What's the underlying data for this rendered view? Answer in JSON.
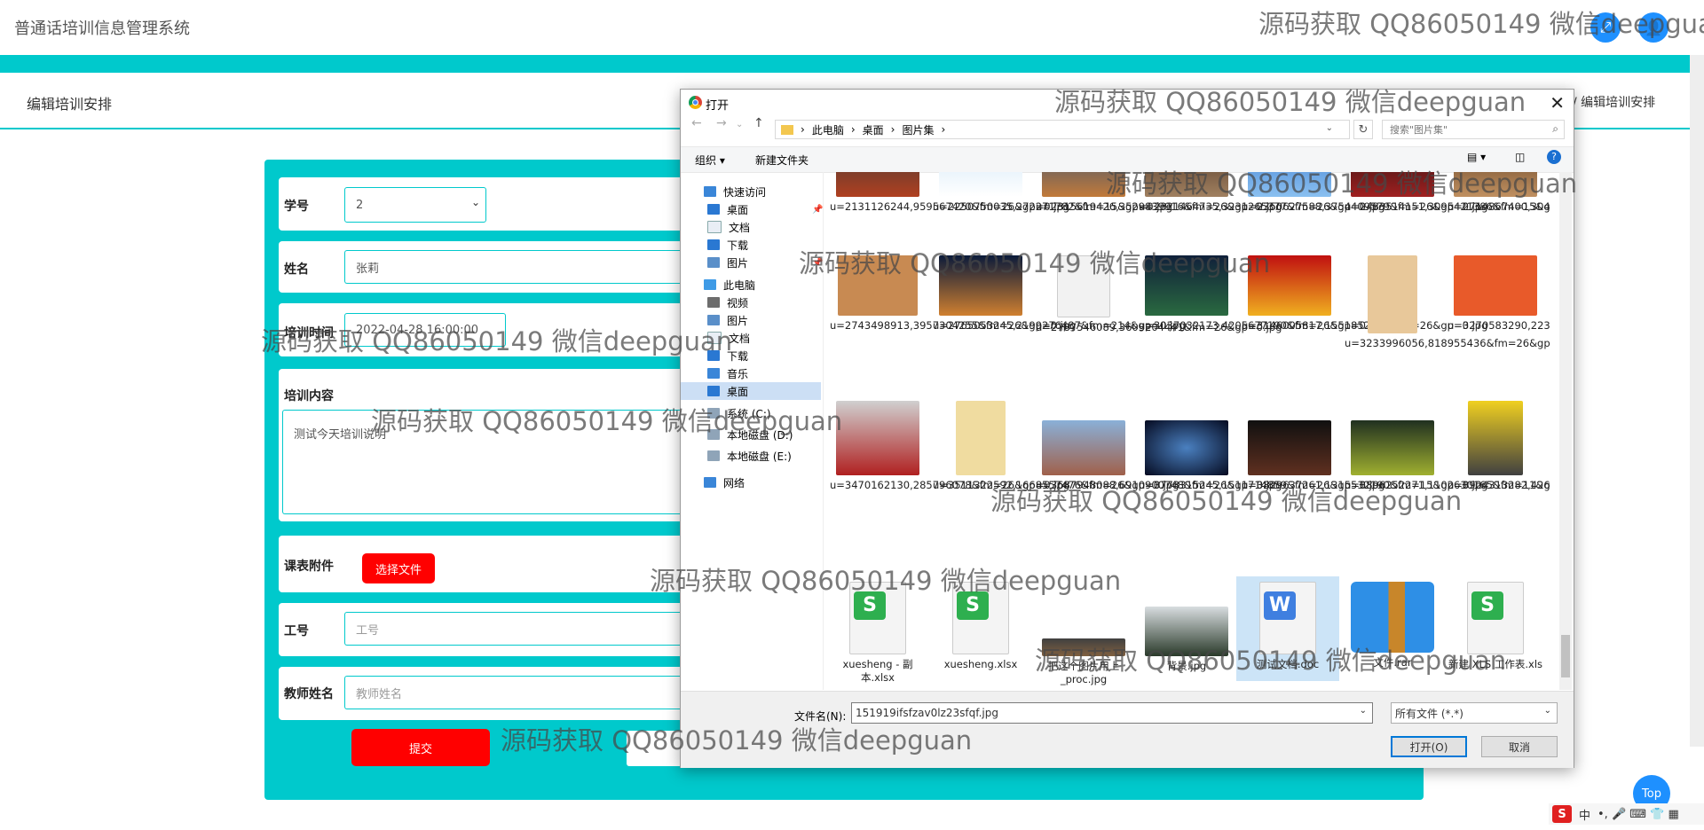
{
  "app": {
    "title": "普通话培训信息管理系统",
    "page_heading": "编辑培训安排",
    "breadcrumb_right": "/ 编辑培训安排"
  },
  "form": {
    "student_id_label": "学号",
    "student_id_value": "2",
    "name_label": "姓名",
    "name_value": "张莉",
    "train_time_label": "培训时间",
    "train_time_value": "2022-04-28 16:00:00",
    "content_label": "培训内容",
    "content_value": "测试今天培训说明",
    "attach_label": "课表附件",
    "attach_button": "选择文件",
    "staff_id_label": "工号",
    "staff_id_placeholder": "工号",
    "teacher_label": "教师姓名",
    "teacher_placeholder": "教师姓名",
    "submit_label": "提交"
  },
  "dialog": {
    "title": "打开",
    "path": [
      "此电脑",
      "桌面",
      "图片集"
    ],
    "search_placeholder": "搜索\"图片集\"",
    "cmd_organize": "组织 ▾",
    "cmd_new_folder": "新建文件夹",
    "nav": [
      {
        "label": "快速访问",
        "icon": "star-icon"
      },
      {
        "label": "桌面",
        "icon": "desktop-icon"
      },
      {
        "label": "文档",
        "icon": "document-icon"
      },
      {
        "label": "下载",
        "icon": "download-icon"
      },
      {
        "label": "图片",
        "icon": "picture-icon"
      },
      {
        "label": "此电脑",
        "icon": "computer-icon"
      },
      {
        "label": "视频",
        "icon": "video-icon"
      },
      {
        "label": "图片",
        "icon": "picture-icon"
      },
      {
        "label": "文档",
        "icon": "document-icon"
      },
      {
        "label": "下载",
        "icon": "download-icon"
      },
      {
        "label": "音乐",
        "icon": "music-icon"
      },
      {
        "label": "桌面",
        "icon": "desktop-icon"
      },
      {
        "label": "系统 (C:)",
        "icon": "drive-icon"
      },
      {
        "label": "本地磁盘 (D:)",
        "icon": "drive-icon"
      },
      {
        "label": "本地磁盘 (E:)",
        "icon": "drive-icon"
      },
      {
        "label": "网络",
        "icon": "network-icon"
      }
    ],
    "files_row1": [
      "u=2131126244,959567420&fm=26&gp=0.jpg",
      "u=2250750035,272271782&fm=15&gp=0.jpg",
      "u=2315619426,3529839916&fm=26&gp=0.jpg",
      "u=2321464735,3231265377&fm=26&gp=0.jpg",
      "u=2350627588,3754409579&fm=26&gp=0.jpg",
      "u=2483514151,3095421386&fm=15&gp=0.jpg",
      "u=2714867400,3049018064&fm=26&gp=0.jpg"
    ],
    "files_row2": [
      "u=2743498913,3957304255&fm=26&gp=0.jpg",
      "u=2765053245,2199276487&fm=214&gp=0.jpg",
      "u=2787546089,3603204441&fm=26&gp=0.jpg",
      "u=3037032173,4205677190&fm=26&gp=0.jpg",
      "u=3146005817,1551852664&fm=26&gp=0.jpg",
      "u=3233996056,818955436&fm=26&gp=0.jpg",
      "u=3270583290,2234983080&fm=26&gp=0.jpg"
    ],
    "files_row3": [
      "u=3470162130,285796078&fm=26&gp=0.jpg",
      "u=3511322592,1668557476&fm=26&gp=0.jpg",
      "u=3687948088,6910900748&fm=26&gp=0.jpg",
      "u=3773315245,1511714859&fm=26&gp=0.jpg",
      "u=3829637261,1315532190&fm=15&gp=0.jpg",
      "u=3896252271,1102630165&fm=11&gp=0.jpg",
      "u=3924313282,42697065&fm=26&gp=0.jpg"
    ],
    "files_row4": [
      "xuesheng - 副本.xlsx",
      "xuesheng.xlsx",
      "把这个图片用上_proc.jpg",
      "背景.jpg",
      "测试文档.doc",
      "文件.rar",
      "新建 XLS 工作表.xls"
    ],
    "filename_label": "文件名(N):",
    "filename_value": "151919ifsfzav0lz23sfqf.jpg",
    "filetype_value": "所有文件 (*.*)",
    "open_button": "打开(O)",
    "cancel_button": "取消"
  },
  "floating": {
    "top_button": "Top",
    "ime_s": "S",
    "ime_lang": "中",
    "ime_rest": "•, 🎤 ⌨ 👕 ▦"
  },
  "watermark": "源码获取 QQ86050149 微信deepguan"
}
